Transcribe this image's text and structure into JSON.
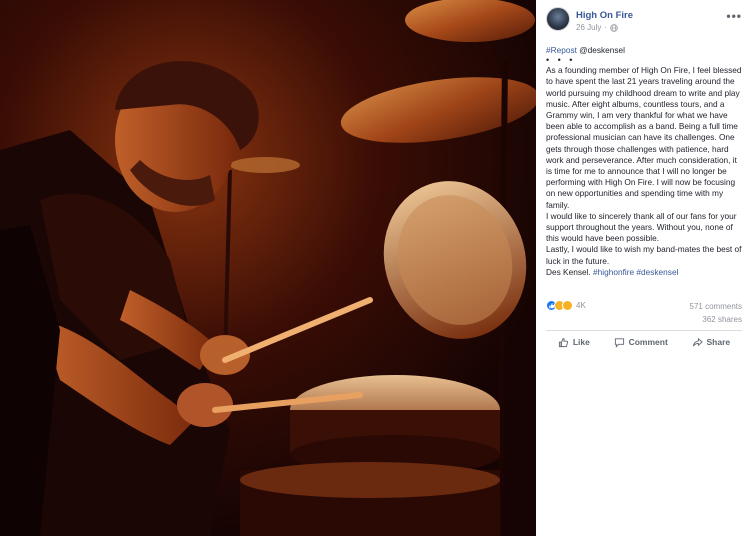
{
  "post": {
    "page_name": "High On Fire",
    "date": "26 July",
    "more_label": "•••",
    "repost_tag": "#Repost",
    "repost_handle": "@deskensel",
    "dots": "• • •",
    "paragraph_1": "As a founding member of High On Fire, I feel blessed to have spent the last 21 years traveling around the world pursuing my childhood dream to write and play music. After eight albums, countless tours, and a Grammy win, I am very thankful for what we have been able to accomplish as a band. Being a full time professional musician can have its challenges. One gets through those challenges with patience, hard work and perseverance. After much consideration, it is time for me to announce that I will no longer be performing with High On Fire. I will now be focusing on new opportunities and spending time with my family.",
    "paragraph_2": "I would like to sincerely thank all of our fans for your support throughout the years. Without you, none of this would have been possible.",
    "paragraph_3": "Lastly, I would like to wish my band-mates the best of luck in the future.",
    "signature_name": "Des Kensel.",
    "hashtag_1": "#highonfire",
    "hashtag_2": "#deskensel"
  },
  "engagement": {
    "reaction_count": "4K",
    "comments": "571 comments",
    "shares": "362 shares",
    "reaction_icons": [
      "like-icon",
      "haha-icon",
      "wow-icon"
    ]
  },
  "actions": {
    "like_label": "Like",
    "comment_label": "Comment",
    "share_label": "Share"
  },
  "colors": {
    "link": "#385898",
    "muted": "#90949c",
    "action_text": "#606770",
    "photo_tint": "#c8501c"
  }
}
